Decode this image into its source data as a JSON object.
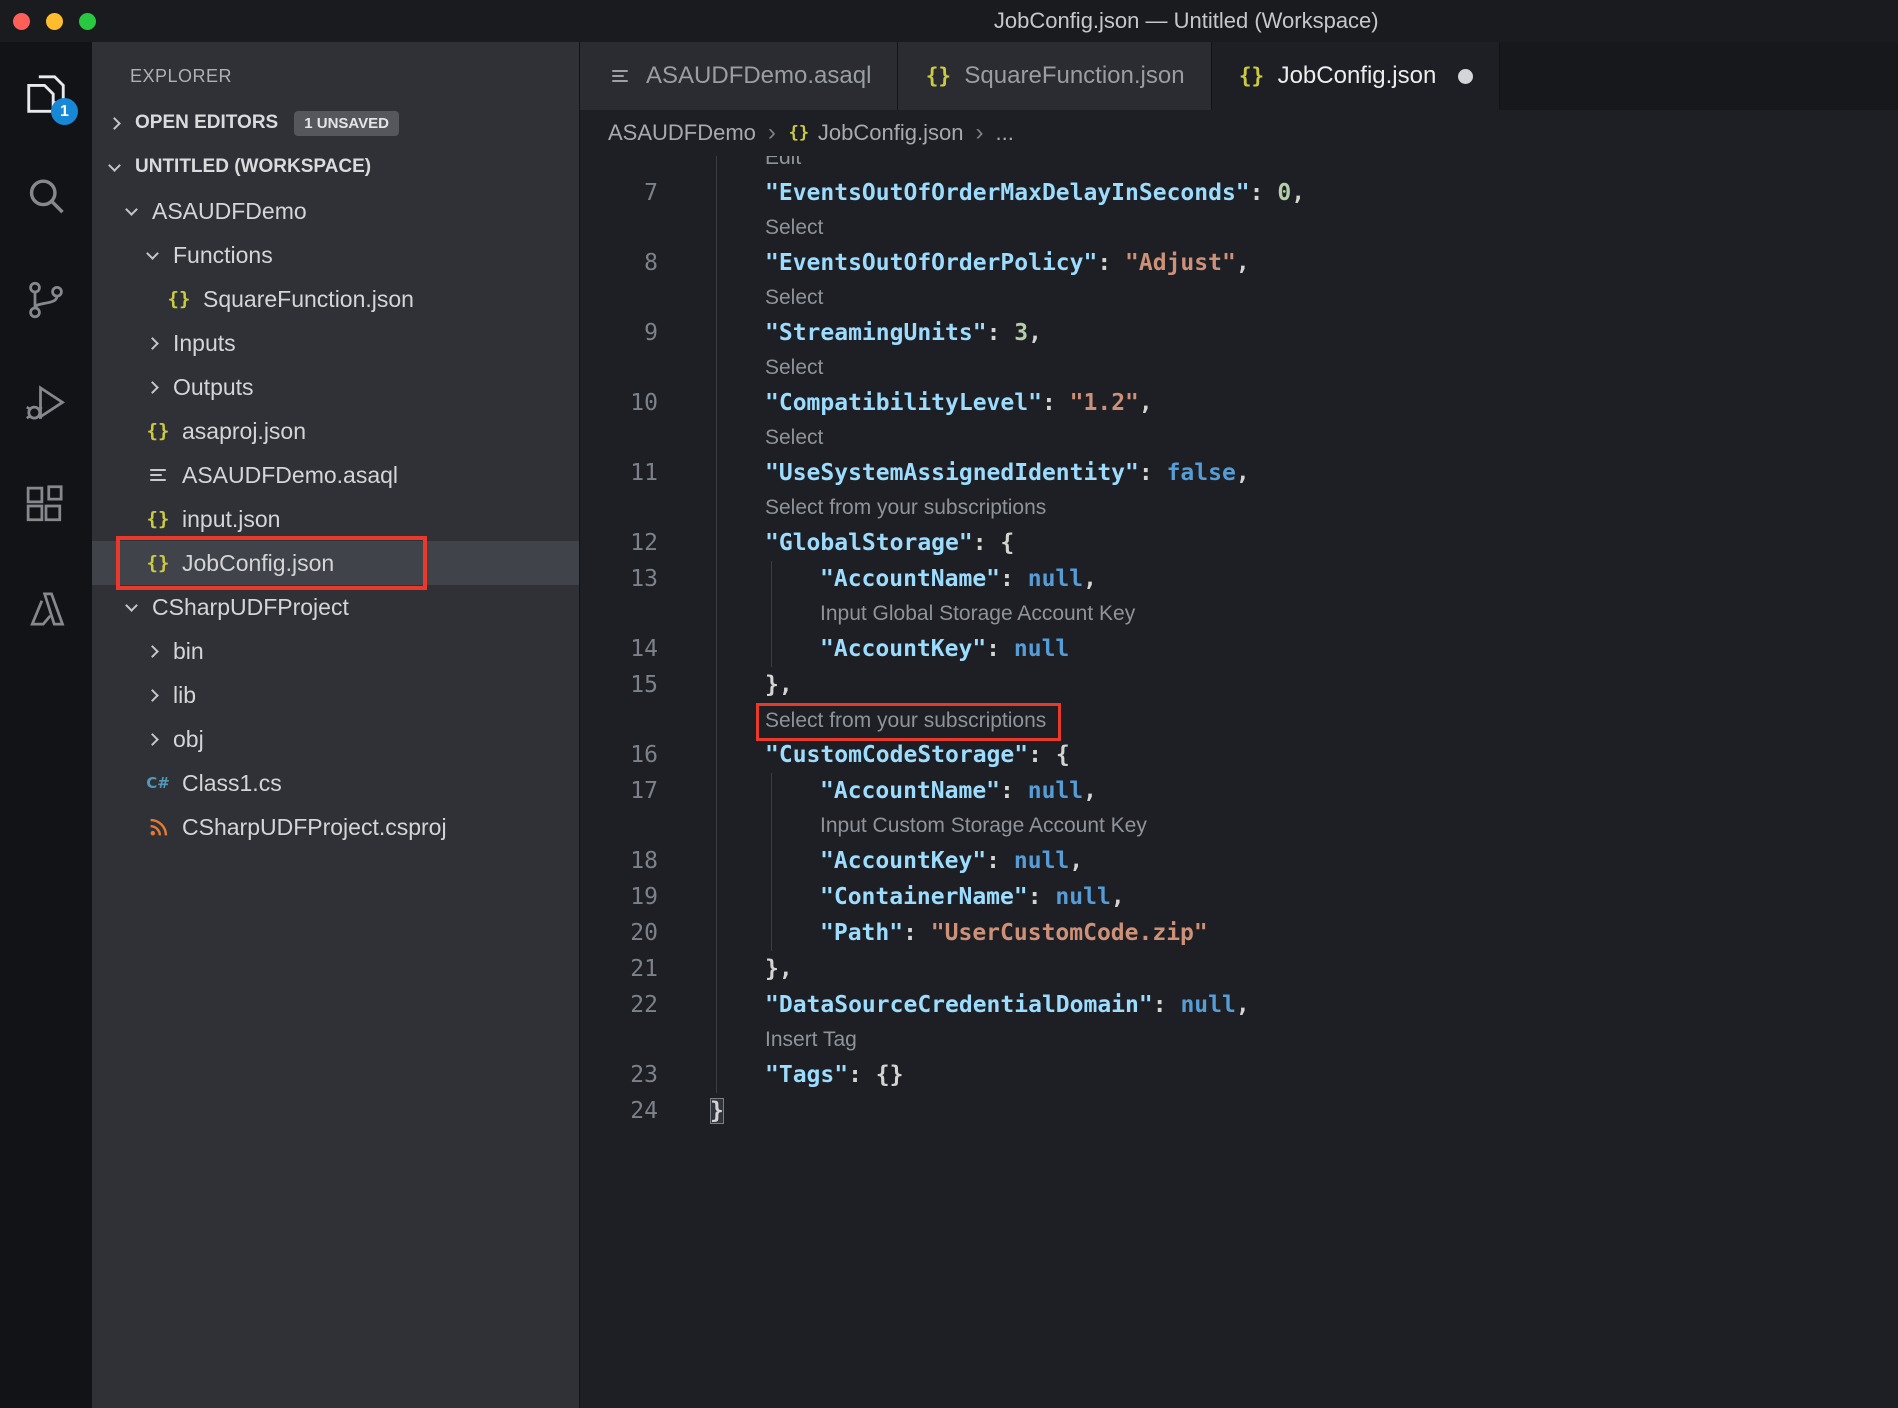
{
  "window": {
    "title": "JobConfig.json — Untitled (Workspace)"
  },
  "colors": {
    "bg_titlebar": "#1a1b1e",
    "bg_activitybar": "#121317",
    "bg_sidebar": "#2f3136",
    "bg_sidebar_selected": "#40434a",
    "bg_editor": "#1d1f24",
    "bg_tabbar": "#17181c",
    "bg_tab_inactive": "#2a2c31",
    "fg_code": "#d4d4d4",
    "fg_key": "#9cdcfe",
    "fg_string": "#ce9178",
    "fg_number": "#b5cea8",
    "fg_keyword": "#569cd6",
    "fg_lens": "#8f939a",
    "fg_linenum": "#7d8189",
    "annotation_red": "#e8392a",
    "badge_blue": "#1788d6",
    "icon_yellow": "#cbcb41",
    "icon_orange": "#e37933",
    "icon_csharp": "#519aba"
  },
  "activity_bar": {
    "items": [
      {
        "name": "explorer",
        "active": true,
        "badge": "1"
      },
      {
        "name": "search"
      },
      {
        "name": "source-control"
      },
      {
        "name": "run-debug"
      },
      {
        "name": "extensions"
      },
      {
        "name": "azure"
      }
    ]
  },
  "sidebar": {
    "title": "EXPLORER",
    "open_editors": {
      "label": "OPEN EDITORS",
      "badge": "1 UNSAVED"
    },
    "workspace_label": "UNTITLED (WORKSPACE)",
    "tree": [
      {
        "label": "ASAUDFDemo",
        "depth": 1,
        "chevron": "expanded"
      },
      {
        "label": "Functions",
        "depth": 2,
        "chevron": "expanded"
      },
      {
        "label": "SquareFunction.json",
        "depth": 3,
        "icon": "json"
      },
      {
        "label": "Inputs",
        "depth": 2,
        "chevron": "collapsed"
      },
      {
        "label": "Outputs",
        "depth": 2,
        "chevron": "collapsed"
      },
      {
        "label": "asaproj.json",
        "depth": 2,
        "icon": "json"
      },
      {
        "label": "ASAUDFDemo.asaql",
        "depth": 2,
        "icon": "asaql"
      },
      {
        "label": "input.json",
        "depth": 2,
        "icon": "json"
      },
      {
        "label": "JobConfig.json",
        "depth": 2,
        "icon": "json",
        "selected": true,
        "redbox": true
      },
      {
        "label": "CSharpUDFProject",
        "depth": 1,
        "chevron": "expanded"
      },
      {
        "label": "bin",
        "depth": 2,
        "chevron": "collapsed"
      },
      {
        "label": "lib",
        "depth": 2,
        "chevron": "collapsed"
      },
      {
        "label": "obj",
        "depth": 2,
        "chevron": "collapsed"
      },
      {
        "label": "Class1.cs",
        "depth": 2,
        "icon": "csharp"
      },
      {
        "label": "CSharpUDFProject.csproj",
        "depth": 2,
        "icon": "csproj"
      }
    ]
  },
  "editor": {
    "tabs": [
      {
        "label": "ASAUDFDemo.asaql",
        "icon": "asaql",
        "active": false
      },
      {
        "label": "SquareFunction.json",
        "icon": "json",
        "active": false
      },
      {
        "label": "JobConfig.json",
        "icon": "json",
        "active": true,
        "dirty": true
      }
    ],
    "breadcrumb": [
      {
        "label": "ASAUDFDemo"
      },
      {
        "label": "JobConfig.json",
        "icon": "json"
      },
      {
        "label": "..."
      }
    ],
    "lines": [
      {
        "kind": "lens",
        "text": "Edit",
        "indent": 1,
        "guides": [
          0
        ],
        "clip": true
      },
      {
        "kind": "code",
        "num": 7,
        "indent": 1,
        "guides": [
          0
        ],
        "tokens": [
          [
            "\"EventsOutOfOrderMaxDelayInSeconds\"",
            "key"
          ],
          [
            ": ",
            "p"
          ],
          [
            "0",
            "num"
          ],
          [
            ",",
            "p"
          ]
        ]
      },
      {
        "kind": "lens",
        "text": "Select",
        "indent": 1,
        "guides": [
          0
        ]
      },
      {
        "kind": "code",
        "num": 8,
        "indent": 1,
        "guides": [
          0
        ],
        "tokens": [
          [
            "\"EventsOutOfOrderPolicy\"",
            "key"
          ],
          [
            ": ",
            "p"
          ],
          [
            "\"Adjust\"",
            "str"
          ],
          [
            ",",
            "p"
          ]
        ]
      },
      {
        "kind": "lens",
        "text": "Select",
        "indent": 1,
        "guides": [
          0
        ]
      },
      {
        "kind": "code",
        "num": 9,
        "indent": 1,
        "guides": [
          0
        ],
        "tokens": [
          [
            "\"StreamingUnits\"",
            "key"
          ],
          [
            ": ",
            "p"
          ],
          [
            "3",
            "num"
          ],
          [
            ",",
            "p"
          ]
        ]
      },
      {
        "kind": "lens",
        "text": "Select",
        "indent": 1,
        "guides": [
          0
        ]
      },
      {
        "kind": "code",
        "num": 10,
        "indent": 1,
        "guides": [
          0
        ],
        "tokens": [
          [
            "\"CompatibilityLevel\"",
            "key"
          ],
          [
            ": ",
            "p"
          ],
          [
            "\"1.2\"",
            "str"
          ],
          [
            ",",
            "p"
          ]
        ]
      },
      {
        "kind": "lens",
        "text": "Select",
        "indent": 1,
        "guides": [
          0
        ]
      },
      {
        "kind": "code",
        "num": 11,
        "indent": 1,
        "guides": [
          0
        ],
        "tokens": [
          [
            "\"UseSystemAssignedIdentity\"",
            "key"
          ],
          [
            ": ",
            "p"
          ],
          [
            "false",
            "kw"
          ],
          [
            ",",
            "p"
          ]
        ]
      },
      {
        "kind": "lens",
        "text": "Select from your subscriptions",
        "indent": 1,
        "guides": [
          0
        ]
      },
      {
        "kind": "code",
        "num": 12,
        "indent": 1,
        "guides": [
          0
        ],
        "tokens": [
          [
            "\"GlobalStorage\"",
            "key"
          ],
          [
            ": ",
            "p"
          ],
          [
            "{",
            "p"
          ]
        ]
      },
      {
        "kind": "code",
        "num": 13,
        "indent": 2,
        "guides": [
          0,
          1
        ],
        "tokens": [
          [
            "\"AccountName\"",
            "key"
          ],
          [
            ": ",
            "p"
          ],
          [
            "null",
            "kw"
          ],
          [
            ",",
            "p"
          ]
        ]
      },
      {
        "kind": "lens",
        "text": "Input Global Storage Account Key",
        "indent": 2,
        "guides": [
          0,
          1
        ]
      },
      {
        "kind": "code",
        "num": 14,
        "indent": 2,
        "guides": [
          0,
          1
        ],
        "tokens": [
          [
            "\"AccountKey\"",
            "key"
          ],
          [
            ": ",
            "p"
          ],
          [
            "null",
            "kw"
          ]
        ]
      },
      {
        "kind": "code",
        "num": 15,
        "indent": 1,
        "guides": [
          0
        ],
        "tokens": [
          [
            "},",
            "p"
          ]
        ]
      },
      {
        "kind": "lens",
        "text": "Select from your subscriptions",
        "indent": 1,
        "guides": [
          0
        ],
        "redbox": true
      },
      {
        "kind": "code",
        "num": 16,
        "indent": 1,
        "guides": [
          0
        ],
        "tokens": [
          [
            "\"CustomCodeStorage\"",
            "key"
          ],
          [
            ": ",
            "p"
          ],
          [
            "{",
            "p"
          ]
        ]
      },
      {
        "kind": "code",
        "num": 17,
        "indent": 2,
        "guides": [
          0,
          1
        ],
        "tokens": [
          [
            "\"AccountName\"",
            "key"
          ],
          [
            ": ",
            "p"
          ],
          [
            "null",
            "kw"
          ],
          [
            ",",
            "p"
          ]
        ]
      },
      {
        "kind": "lens",
        "text": "Input Custom Storage Account Key",
        "indent": 2,
        "guides": [
          0,
          1
        ]
      },
      {
        "kind": "code",
        "num": 18,
        "indent": 2,
        "guides": [
          0,
          1
        ],
        "tokens": [
          [
            "\"AccountKey\"",
            "key"
          ],
          [
            ": ",
            "p"
          ],
          [
            "null",
            "kw"
          ],
          [
            ",",
            "p"
          ]
        ]
      },
      {
        "kind": "code",
        "num": 19,
        "indent": 2,
        "guides": [
          0,
          1
        ],
        "tokens": [
          [
            "\"ContainerName\"",
            "key"
          ],
          [
            ": ",
            "p"
          ],
          [
            "null",
            "kw"
          ],
          [
            ",",
            "p"
          ]
        ]
      },
      {
        "kind": "code",
        "num": 20,
        "indent": 2,
        "guides": [
          0,
          1
        ],
        "tokens": [
          [
            "\"Path\"",
            "key"
          ],
          [
            ": ",
            "p"
          ],
          [
            "\"UserCustomCode.zip\"",
            "str"
          ]
        ]
      },
      {
        "kind": "code",
        "num": 21,
        "indent": 1,
        "guides": [
          0
        ],
        "tokens": [
          [
            "},",
            "p"
          ]
        ]
      },
      {
        "kind": "code",
        "num": 22,
        "indent": 1,
        "guides": [
          0
        ],
        "tokens": [
          [
            "\"DataSourceCredentialDomain\"",
            "key"
          ],
          [
            ": ",
            "p"
          ],
          [
            "null",
            "kw"
          ],
          [
            ",",
            "p"
          ]
        ]
      },
      {
        "kind": "lens",
        "text": "Insert Tag",
        "indent": 1,
        "guides": [
          0
        ]
      },
      {
        "kind": "code",
        "num": 23,
        "indent": 1,
        "guides": [
          0
        ],
        "tokens": [
          [
            "\"Tags\"",
            "key"
          ],
          [
            ": ",
            "p"
          ],
          [
            "{}",
            "p"
          ]
        ]
      },
      {
        "kind": "code",
        "num": 24,
        "indent": 0,
        "guides": [],
        "tokens": [
          [
            "}",
            "match"
          ]
        ]
      }
    ]
  }
}
